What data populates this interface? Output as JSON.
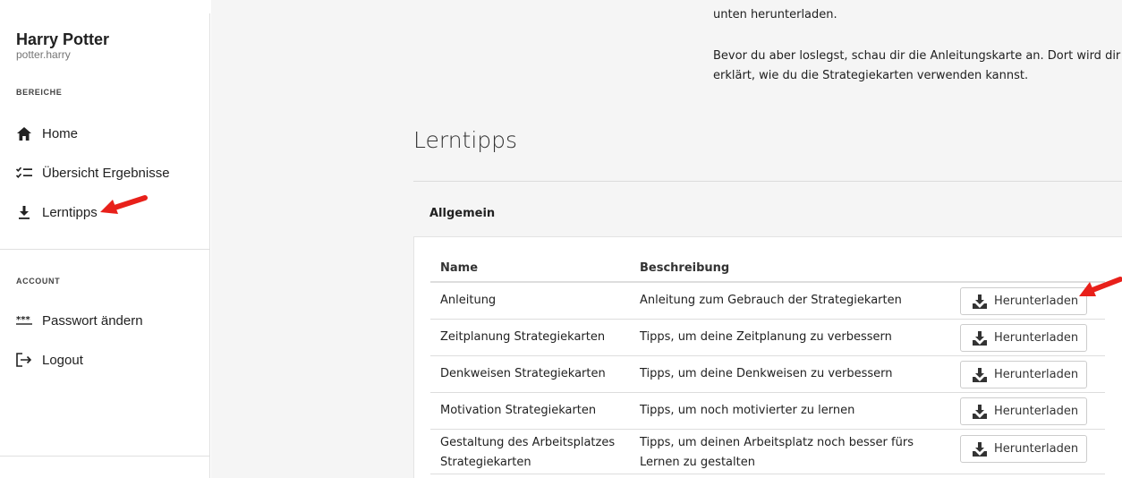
{
  "sidebar": {
    "user": {
      "name": "Harry Potter",
      "login": "potter.harry"
    },
    "sections": [
      {
        "label": "BEREICHE",
        "items": [
          {
            "label": "Home",
            "icon": "home-icon"
          },
          {
            "label": "Übersicht Ergebnisse",
            "icon": "checklist-icon"
          },
          {
            "label": "Lerntipps",
            "icon": "download-icon"
          }
        ]
      },
      {
        "label": "ACCOUNT",
        "items": [
          {
            "label": "Passwort ändern",
            "icon": "password-icon"
          },
          {
            "label": "Logout",
            "icon": "logout-icon"
          }
        ]
      }
    ]
  },
  "main": {
    "intro": {
      "line1": "unten herunterladen.",
      "paragraph2": "Bevor du aber loslegst, schau dir die Anleitungskarte an. Dort wird dir erklärt, wie du die Strategiekarten verwenden kannst."
    },
    "section_title": "Lerntipps",
    "sub_heading": "Allgemein",
    "table": {
      "columns": [
        "Name",
        "Beschreibung"
      ],
      "button_label": "Herunterladen",
      "rows": [
        {
          "name": "Anleitung",
          "description": "Anleitung zum Gebrauch der Strategiekarten"
        },
        {
          "name": "Zeitplanung Strategiekarten",
          "description": "Tipps, um deine Zeitplanung zu verbessern"
        },
        {
          "name": "Denkweisen Strategiekarten",
          "description": "Tipps, um deine Denkweisen zu verbessern"
        },
        {
          "name": "Motivation Strategiekarten",
          "description": "Tipps, um noch motivierter zu lernen"
        },
        {
          "name": "Gestaltung des Arbeitsplatzes Strategiekarten",
          "description": "Tipps, um deinen Arbeitsplatz noch besser fürs Lernen zu gestalten"
        }
      ]
    }
  },
  "colors": {
    "annotation_arrow": "#e8201a",
    "main_bg": "#f5f5f5",
    "sidebar_bg": "#ffffff"
  }
}
